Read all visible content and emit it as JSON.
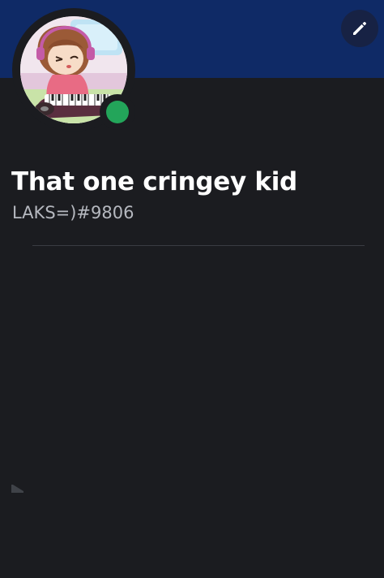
{
  "banner": {
    "color": "#0f2a66"
  },
  "edit_button": {
    "icon": "pencil-icon"
  },
  "avatar": {
    "status": "online",
    "status_color": "#23a55a"
  },
  "profile": {
    "display_name": "That one cringey kid",
    "username": "LAKS=)#9806"
  }
}
